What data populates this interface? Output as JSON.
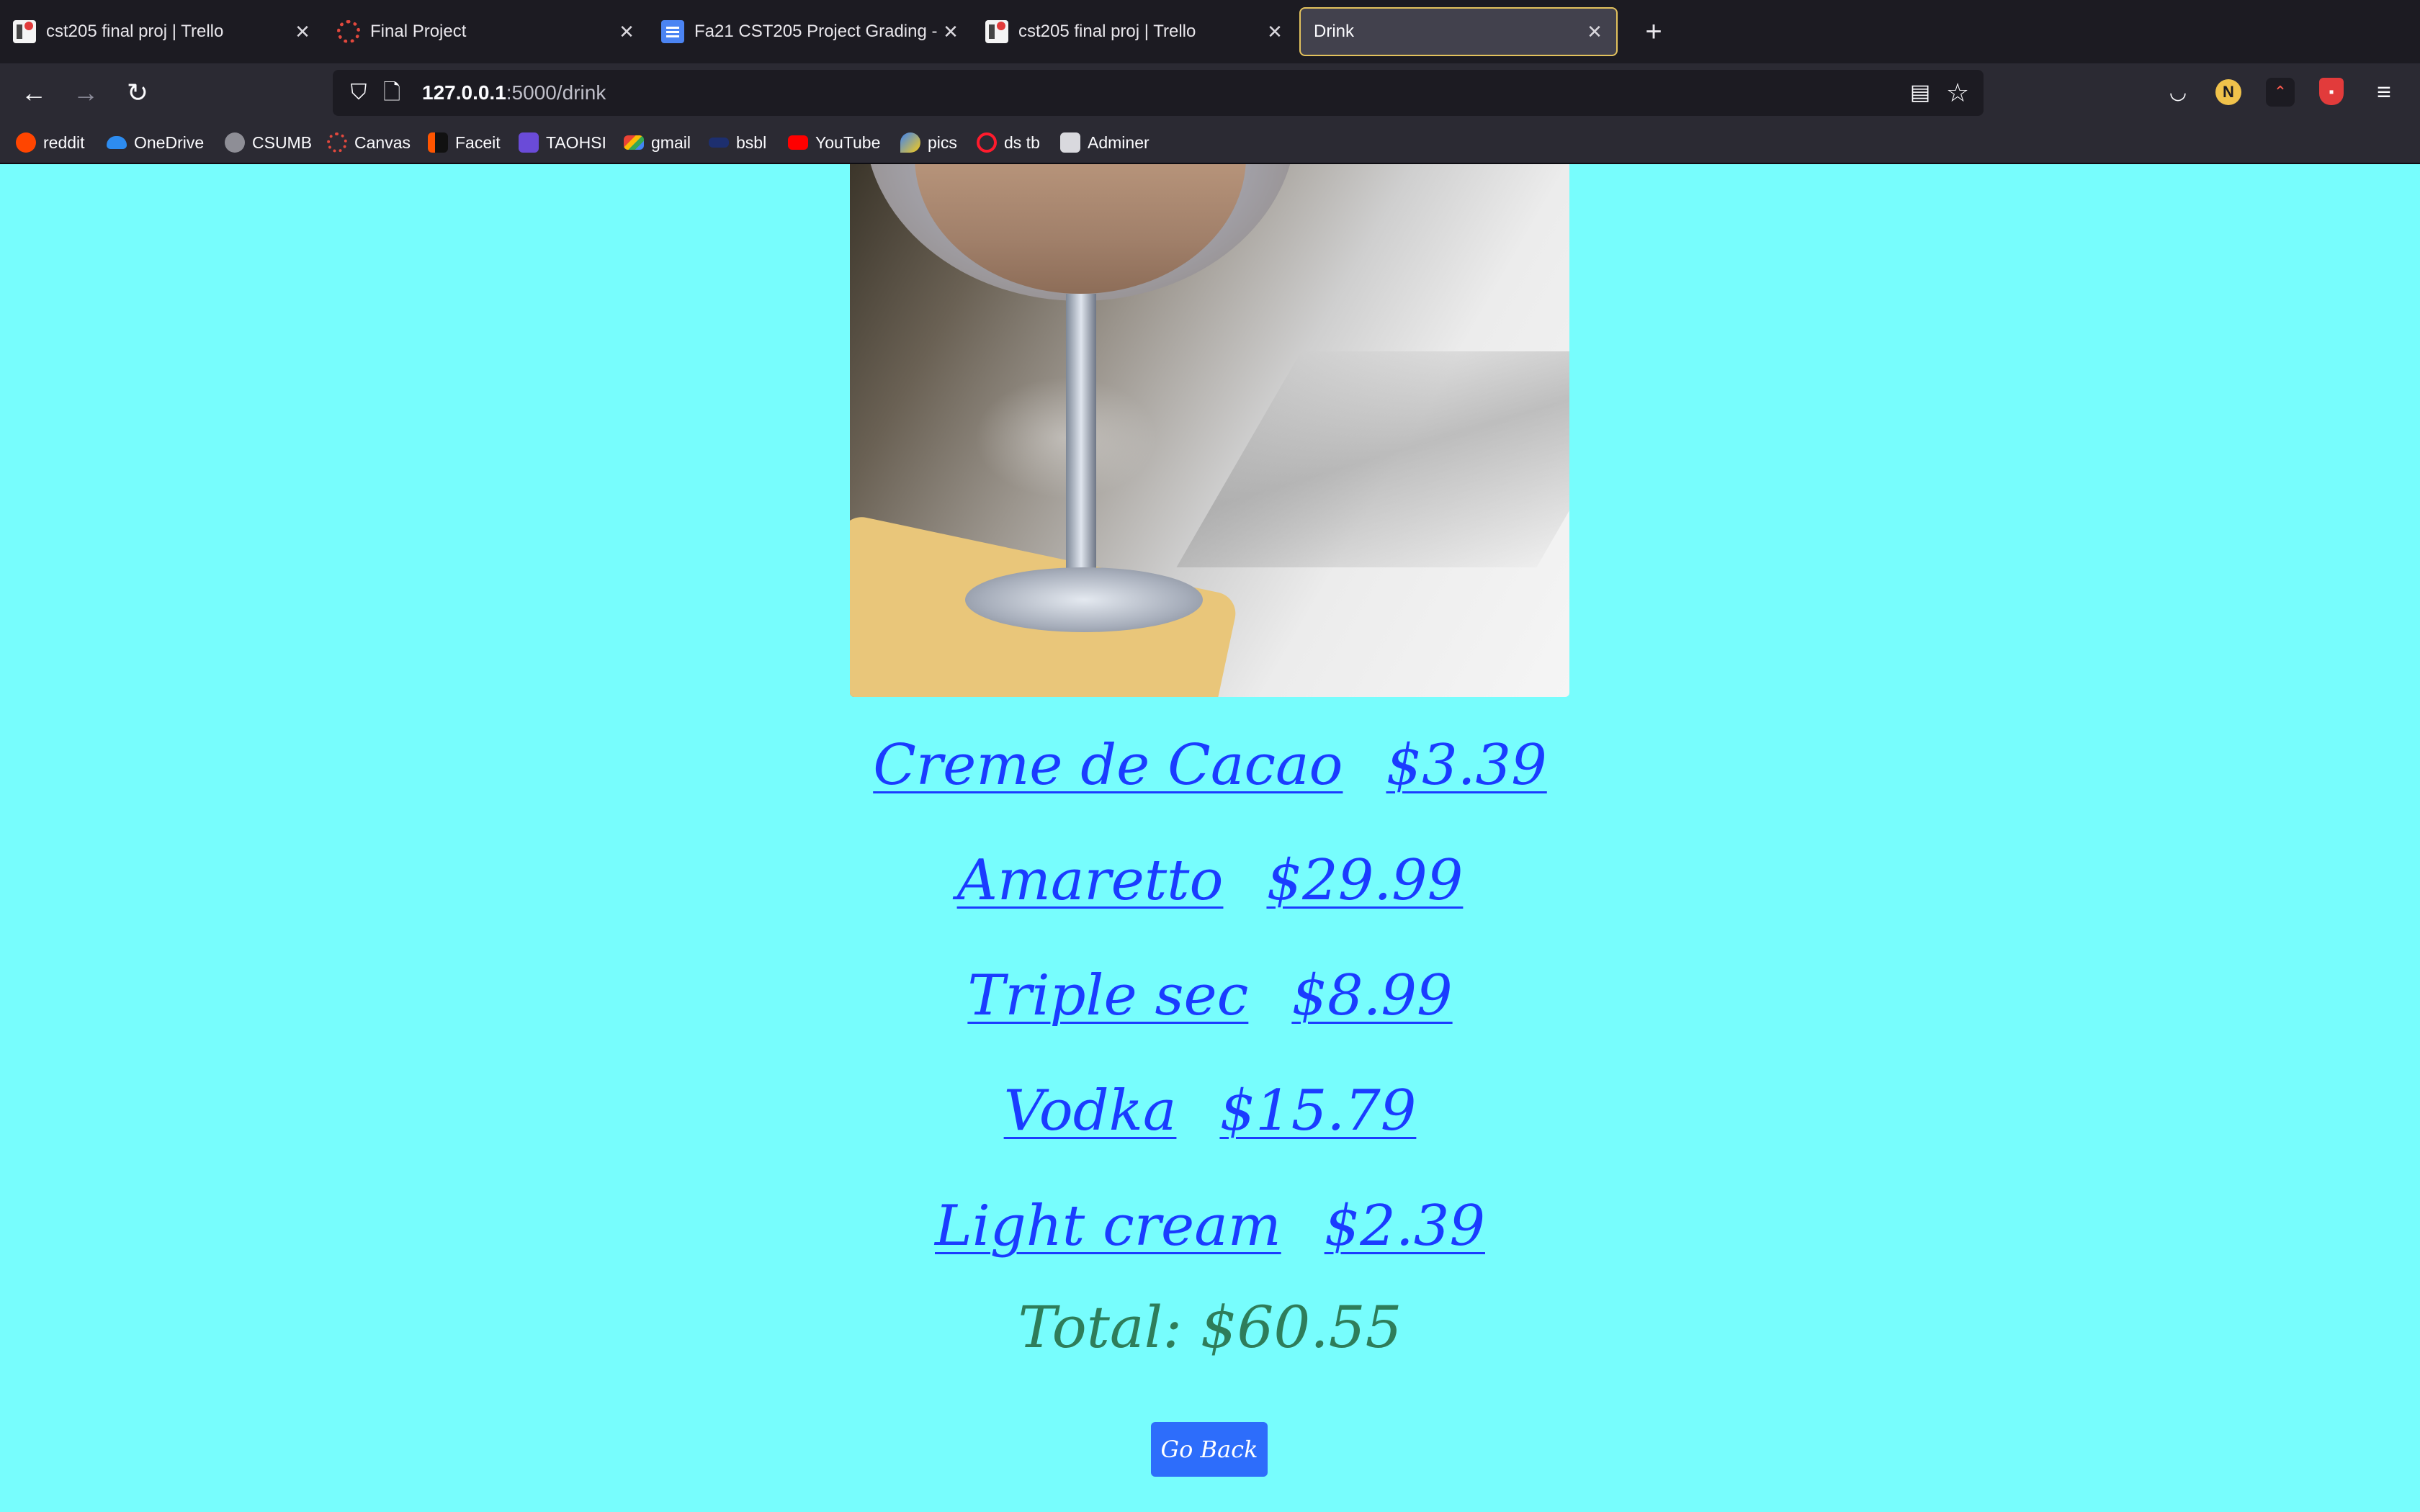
{
  "browser": {
    "tabs": [
      {
        "title": "cst205 final proj | Trello",
        "icon": "trello-icon",
        "active": false
      },
      {
        "title": "Final Project",
        "icon": "canvas-icon",
        "active": false
      },
      {
        "title": "Fa21 CST205 Project Grading -",
        "icon": "google-docs-icon",
        "active": false
      },
      {
        "title": "cst205 final proj | Trello",
        "icon": "trello-icon",
        "active": false
      },
      {
        "title": "Drink",
        "icon": "",
        "active": true
      }
    ],
    "url_host": "127.0.0.1",
    "url_rest": ":5000/drink",
    "profile_initial": "N",
    "bookmarks": [
      {
        "label": "reddit",
        "icon": "reddit-icon"
      },
      {
        "label": "OneDrive",
        "icon": "onedrive-icon"
      },
      {
        "label": "CSUMB",
        "icon": "csumb-icon"
      },
      {
        "label": "Canvas",
        "icon": "canvas-icon"
      },
      {
        "label": "Faceit",
        "icon": "faceit-icon"
      },
      {
        "label": "TAOHSI",
        "icon": "list-icon"
      },
      {
        "label": "gmail",
        "icon": "gmail-icon"
      },
      {
        "label": "bsbl",
        "icon": "bsbl-icon"
      },
      {
        "label": "YouTube",
        "icon": "youtube-icon"
      },
      {
        "label": "pics",
        "icon": "pics-icon"
      },
      {
        "label": "ds tb",
        "icon": "opera-icon"
      },
      {
        "label": "Adminer",
        "icon": "adminer-icon"
      }
    ]
  },
  "page": {
    "items": [
      {
        "name": "Creme de Cacao",
        "price": "$3.39"
      },
      {
        "name": "Amaretto",
        "price": "$29.99"
      },
      {
        "name": "Triple sec",
        "price": "$8.99"
      },
      {
        "name": "Vodka",
        "price": "$15.79"
      },
      {
        "name": "Light cream",
        "price": "$2.39"
      }
    ],
    "total_label": "Total: $60.55",
    "back_button": "Go Back"
  },
  "colors": {
    "page_background": "#77fdfd",
    "link": "#1a3cff",
    "total_text": "#2e7d5a",
    "button": "#2d6dfb",
    "active_tab_border": "#e3c25d"
  }
}
